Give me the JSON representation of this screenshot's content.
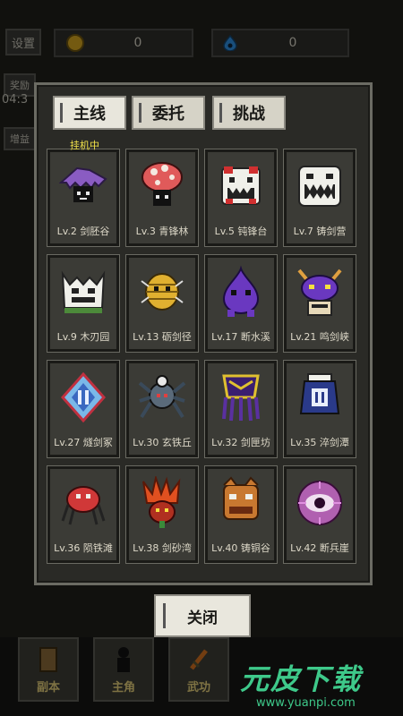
{
  "hud": {
    "settings_label": "设置",
    "reward_label": "奖励",
    "timer": "04:3",
    "boost_label": "增益",
    "coins_value": "0",
    "gems_value": "0"
  },
  "tabs": [
    "主线",
    "委托",
    "挑战"
  ],
  "idle_tag": "挂机中",
  "stages": [
    {
      "caption": "Lv.2 剑胚谷",
      "icon": "purple-shroud-monster-icon"
    },
    {
      "caption": "Lv.3 青锋林",
      "icon": "red-mushroom-monster-icon"
    },
    {
      "caption": "Lv.5 钝锋台",
      "icon": "white-fanged-beast-icon"
    },
    {
      "caption": "Lv.7 铸剑营",
      "icon": "white-skull-beast-icon"
    },
    {
      "caption": "Lv.9 木刃园",
      "icon": "horned-tree-beast-icon"
    },
    {
      "caption": "Lv.13 砺剑径",
      "icon": "golden-scarab-icon"
    },
    {
      "caption": "Lv.17 断水溪",
      "icon": "purple-slime-icon"
    },
    {
      "caption": "Lv.21 鸣剑峡",
      "icon": "horned-purple-demon-icon"
    },
    {
      "caption": "Lv.27 燧剑冢",
      "icon": "blue-crystal-tile-icon"
    },
    {
      "caption": "Lv.30 玄铁丘",
      "icon": "steel-spider-icon"
    },
    {
      "caption": "Lv.32 剑匣坊",
      "icon": "gold-crowned-squid-icon"
    },
    {
      "caption": "Lv.35 淬剑潭",
      "icon": "blue-lantern-golem-icon"
    },
    {
      "caption": "Lv.36 陨铁滩",
      "icon": "red-crab-icon"
    },
    {
      "caption": "Lv.38 剑砂湾",
      "icon": "fire-plant-icon"
    },
    {
      "caption": "Lv.40 铸铜谷",
      "icon": "bronze-ogre-icon"
    },
    {
      "caption": "Lv.42 断兵崖",
      "icon": "violet-eye-orb-icon"
    }
  ],
  "close_label": "关闭",
  "nav": [
    "副本",
    "主角",
    "武功"
  ],
  "watermark": {
    "main": "元皮下载",
    "url": "www.yuanpi.com"
  },
  "colors": {
    "idle_tag": "#f2e24a",
    "panel": "#2a2a26",
    "watermark": "#3ec98a"
  }
}
